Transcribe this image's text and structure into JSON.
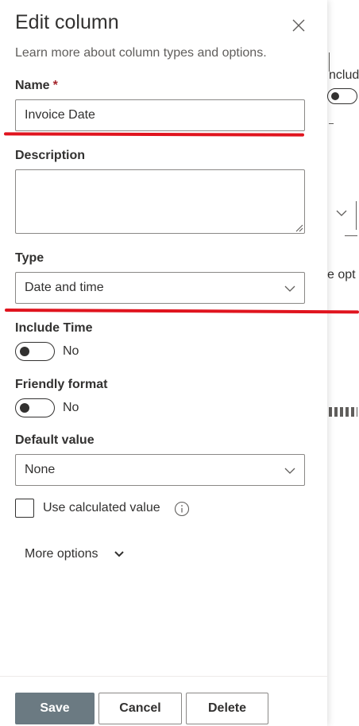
{
  "panel": {
    "title": "Edit column",
    "learn_more": "Learn more about column types and options."
  },
  "name_field": {
    "label": "Name",
    "required_mark": "*",
    "value": "Invoice Date"
  },
  "description_field": {
    "label": "Description",
    "value": ""
  },
  "type_field": {
    "label": "Type",
    "selected": "Date and time"
  },
  "include_time": {
    "label": "Include Time",
    "state": "No",
    "on": false
  },
  "friendly_format": {
    "label": "Friendly format",
    "state": "No",
    "on": false
  },
  "default_value": {
    "label": "Default value",
    "selected": "None"
  },
  "calculated": {
    "label": "Use calculated value",
    "checked": false
  },
  "more_options": {
    "label": "More options"
  },
  "footer": {
    "save": "Save",
    "cancel": "Cancel",
    "delete": "Delete"
  },
  "background": {
    "fragment_1": "nclud",
    "fragment_2": "e opt"
  },
  "colors": {
    "annotation_red": "#e0141e",
    "primary_button": "#6b7a82",
    "required": "#a4262c"
  },
  "icons": {
    "close": "close-icon",
    "chevron": "chevron-down-icon",
    "info": "info-icon"
  }
}
